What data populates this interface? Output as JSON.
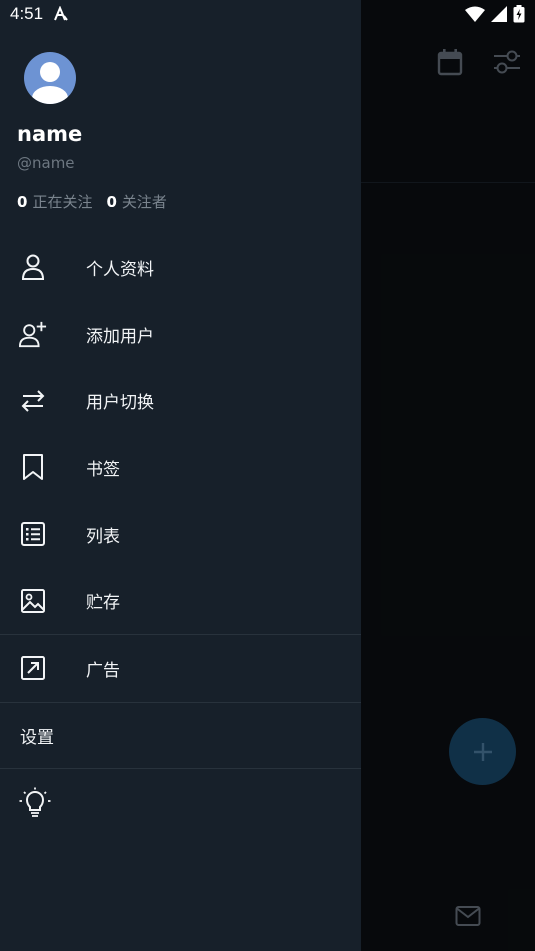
{
  "status_bar": {
    "time": "4:51"
  },
  "profile": {
    "name": "name",
    "handle": "@name",
    "following_count": "0",
    "following_label": "正在关注",
    "followers_count": "0",
    "followers_label": "关注者"
  },
  "menu": {
    "items": [
      {
        "label": "个人资料",
        "icon": "person-icon"
      },
      {
        "label": "添加用户",
        "icon": "add-user-icon"
      },
      {
        "label": "用户切换",
        "icon": "swap-icon"
      },
      {
        "label": "书签",
        "icon": "bookmark-icon"
      },
      {
        "label": "列表",
        "icon": "list-icon"
      },
      {
        "label": "贮存",
        "icon": "image-icon"
      },
      {
        "label": "广告",
        "icon": "external-link-icon"
      }
    ],
    "settings_label": "设置"
  },
  "colors": {
    "drawer_bg": "#17202a",
    "fab_bg": "#1a4a6e",
    "avatar_bg": "#6d93d3"
  }
}
